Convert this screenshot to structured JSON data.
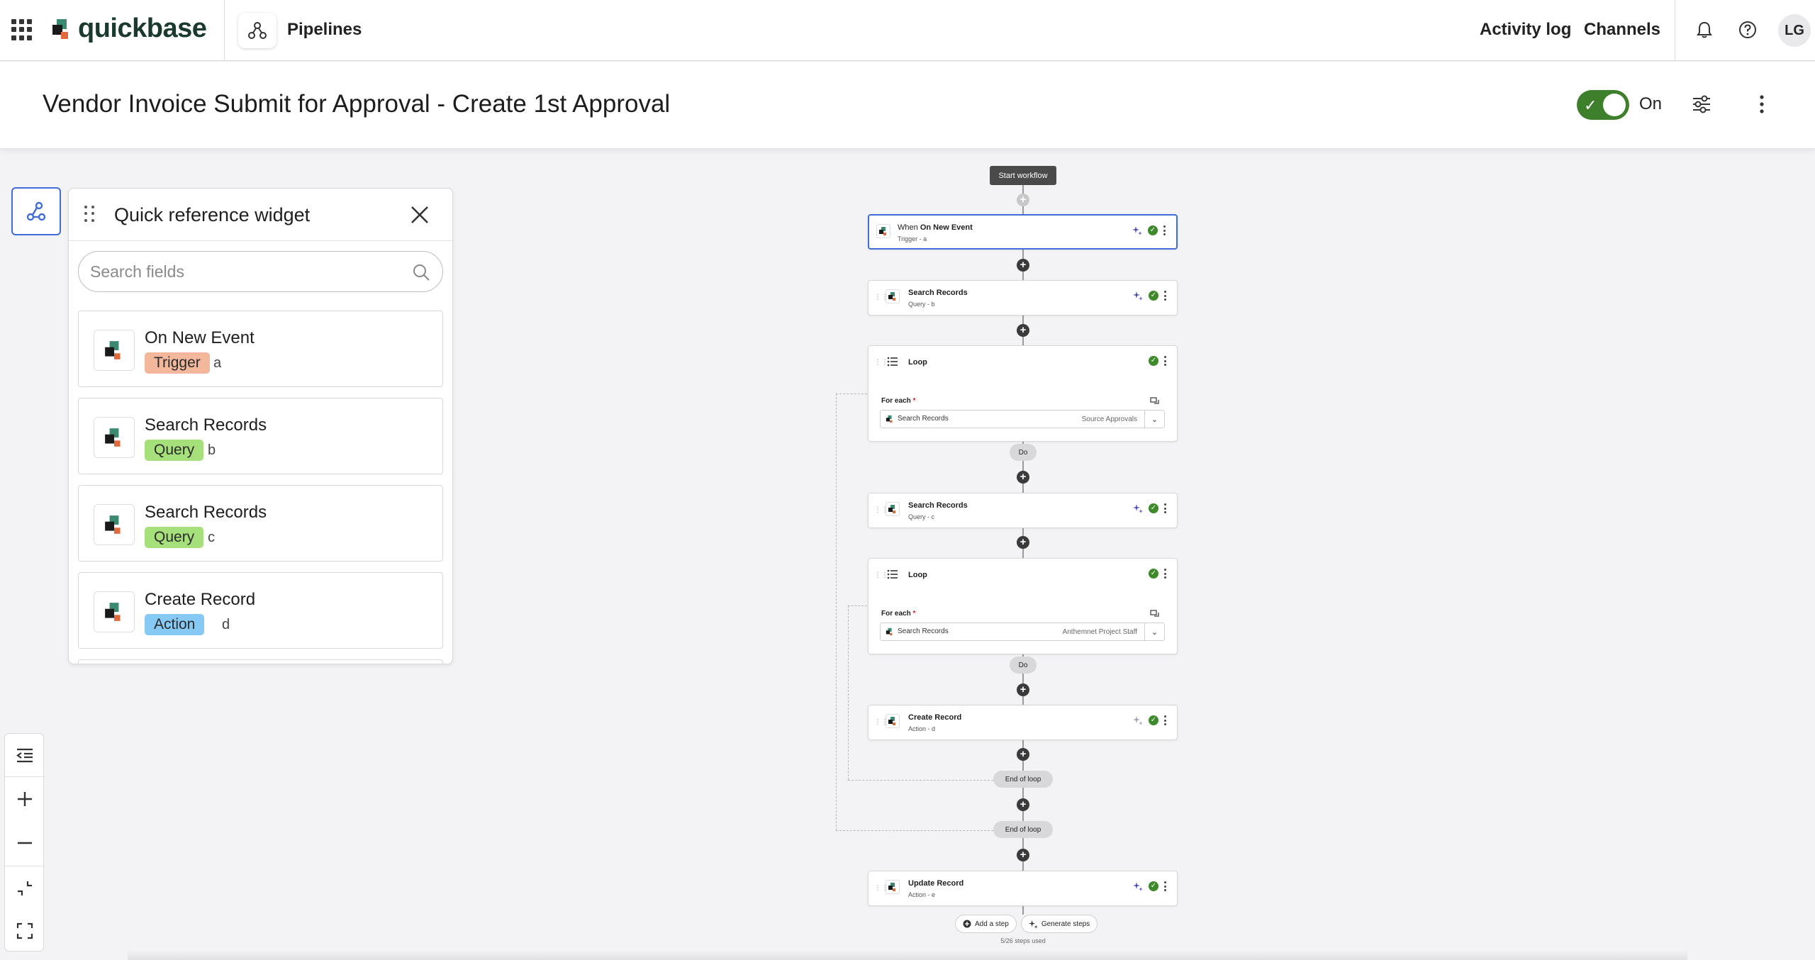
{
  "topnav": {
    "brand": "quickbase",
    "app_label": "Pipelines",
    "links": [
      "Activity log",
      "Channels"
    ],
    "avatar_initials": "LG"
  },
  "titlebar": {
    "title": "Vendor Invoice Submit for Approval - Create 1st Approval",
    "toggle_label": "On",
    "toggle_on": true
  },
  "quick_reference": {
    "title": "Quick reference widget",
    "search_placeholder": "Search fields",
    "items": [
      {
        "name": "On New Event",
        "type": "Trigger",
        "letter": "a"
      },
      {
        "name": "Search Records",
        "type": "Query",
        "letter": "b"
      },
      {
        "name": "Search Records",
        "type": "Query",
        "letter": "c"
      },
      {
        "name": "Create Record",
        "type": "Action",
        "letter": "d"
      }
    ]
  },
  "workflow": {
    "start_label": "Start workflow",
    "trigger": {
      "prefix": "When",
      "name": "On New Event",
      "sub": "Trigger - a"
    },
    "steps": [
      {
        "title": "Search Records",
        "sub": "Query - b"
      },
      {
        "title": "Loop",
        "foreach_label": "For each",
        "required_mark": "*",
        "select_text": "Search Records",
        "select_right": "Source Approvals",
        "do_label": "Do"
      },
      {
        "title": "Search Records",
        "sub": "Query - c"
      },
      {
        "title": "Loop",
        "foreach_label": "For each",
        "required_mark": "*",
        "select_text": "Search Records",
        "select_right": "Anthemnet Project Staff",
        "do_label": "Do"
      },
      {
        "title": "Create Record",
        "sub": "Action - d"
      },
      {
        "title": "Update Record",
        "sub": "Action - e"
      }
    ],
    "end_loop_label": "End of loop",
    "add_step": "Add a step",
    "generate_steps": "Generate steps",
    "steps_used": "5/26 steps used"
  },
  "colors": {
    "accent_blue": "#3f6cd8",
    "toggle_green": "#3d7f2a",
    "trigger_badge": "#f3b89c",
    "query_badge": "#a6e07a",
    "action_badge": "#86c9f4"
  }
}
